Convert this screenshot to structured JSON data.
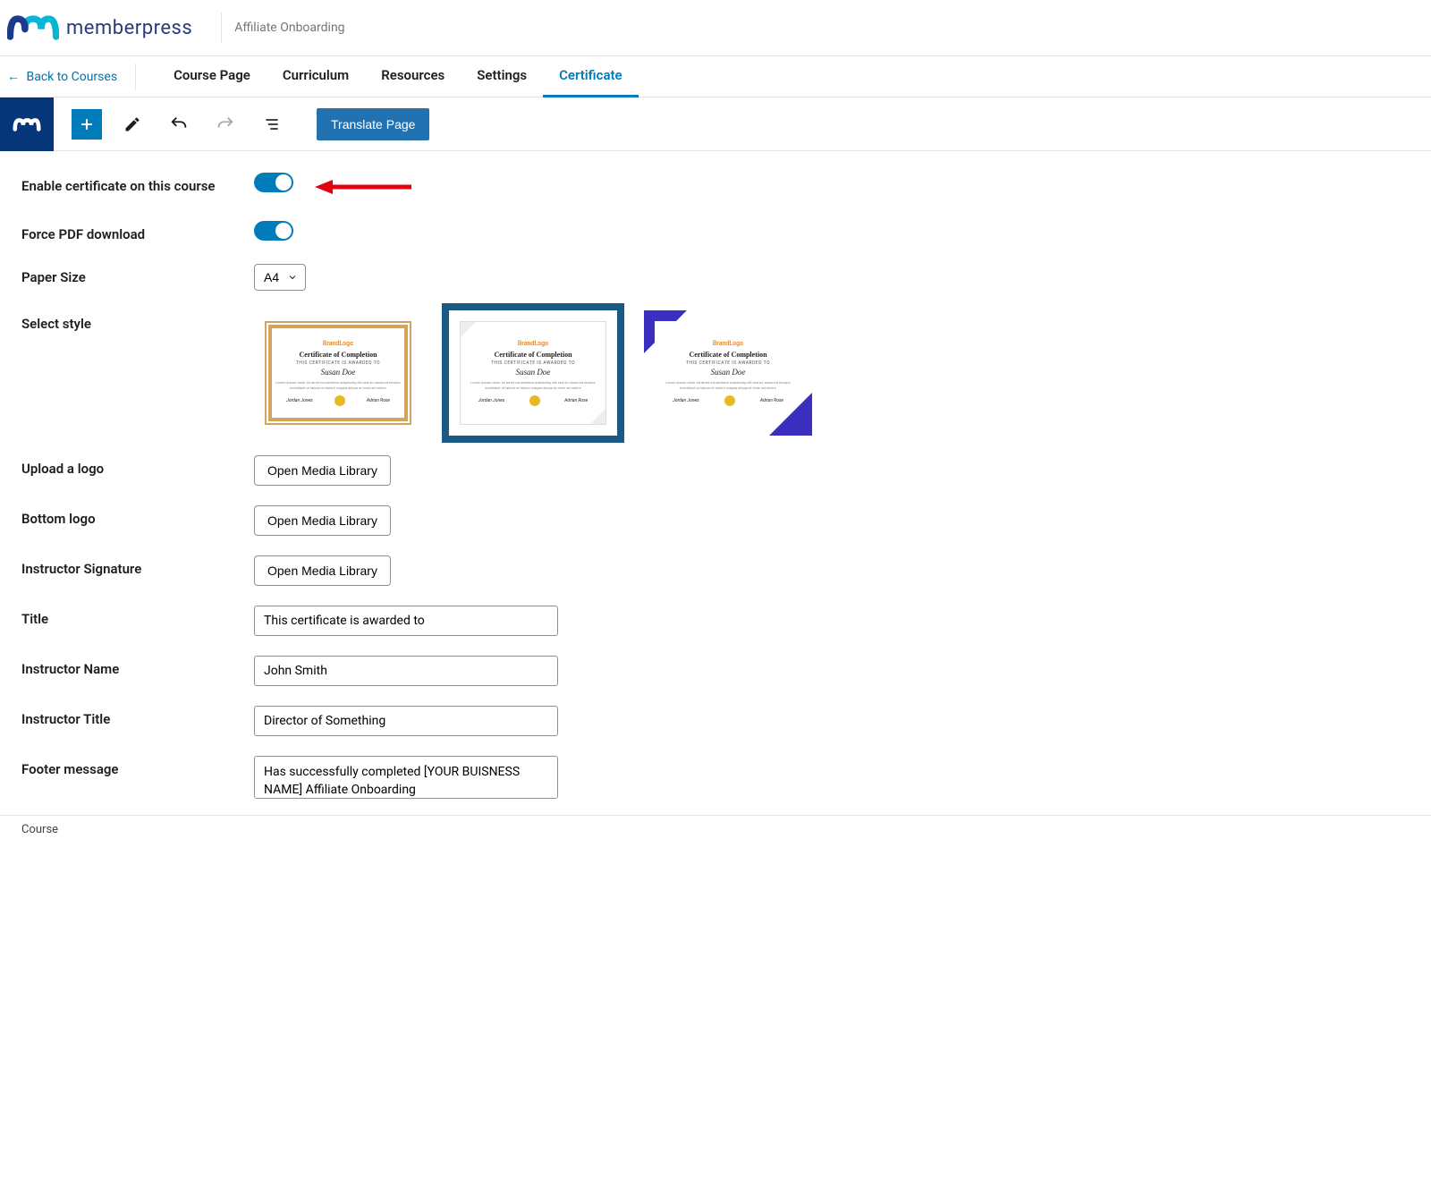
{
  "header": {
    "brand": "memberpress",
    "breadcrumb": "Affiliate Onboarding"
  },
  "nav": {
    "back_label": "Back to Courses",
    "tabs": [
      {
        "label": "Course Page",
        "active": false
      },
      {
        "label": "Curriculum",
        "active": false
      },
      {
        "label": "Resources",
        "active": false
      },
      {
        "label": "Settings",
        "active": false
      },
      {
        "label": "Certificate",
        "active": true
      }
    ]
  },
  "toolbar": {
    "translate_label": "Translate Page"
  },
  "form": {
    "enable_label": "Enable certificate on this course",
    "force_label": "Force PDF download",
    "paper_label": "Paper Size",
    "paper_value": "A4",
    "style_label": "Select style",
    "upload_logo_label": "Upload a logo",
    "bottom_logo_label": "Bottom logo",
    "signature_label": "Instructor Signature",
    "media_button": "Open Media Library",
    "title_label": "Title",
    "title_value": "This certificate is awarded to",
    "instructor_name_label": "Instructor Name",
    "instructor_name_value": "John Smith",
    "instructor_title_label": "Instructor Title",
    "instructor_title_value": "Director of Something",
    "footer_label": "Footer message",
    "footer_value": "Has successfully completed [YOUR BUISNESS NAME] Affiliate Onboarding"
  },
  "cert_preview": {
    "brand": "BrandLogo",
    "title": "Certificate of Completion",
    "sub": "THIS CERTIFICATE IS AWARDED TO",
    "name": "Susan Doe",
    "sig1": "Jordan Jones",
    "sig2": "Adrian Rose"
  },
  "bottom": {
    "label": "Course"
  }
}
